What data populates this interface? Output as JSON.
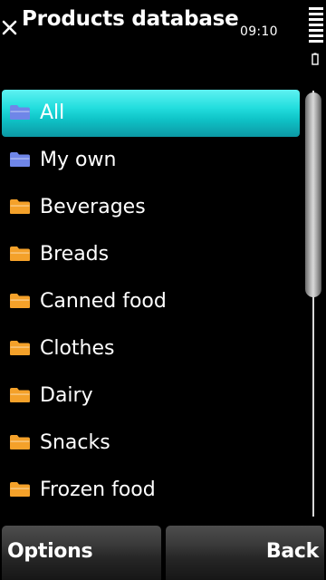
{
  "status_bar": {
    "title": "Products database",
    "time": "09:10",
    "close_icon": "close-icon",
    "signal_icon": "signal-strength-icon",
    "battery_icon": "battery-icon"
  },
  "list": {
    "items": [
      {
        "label": "All",
        "icon": "folder-icon",
        "icon_color": "#6f86e8",
        "selected": true
      },
      {
        "label": "My own",
        "icon": "folder-icon",
        "icon_color": "#6f86e8",
        "selected": false
      },
      {
        "label": "Beverages",
        "icon": "folder-icon",
        "icon_color": "#f4a12a",
        "selected": false
      },
      {
        "label": "Breads",
        "icon": "folder-icon",
        "icon_color": "#f4a12a",
        "selected": false
      },
      {
        "label": "Canned food",
        "icon": "folder-icon",
        "icon_color": "#f4a12a",
        "selected": false
      },
      {
        "label": "Clothes",
        "icon": "folder-icon",
        "icon_color": "#f4a12a",
        "selected": false
      },
      {
        "label": "Dairy",
        "icon": "folder-icon",
        "icon_color": "#f4a12a",
        "selected": false
      },
      {
        "label": "Snacks",
        "icon": "folder-icon",
        "icon_color": "#f4a12a",
        "selected": false
      },
      {
        "label": "Frozen food",
        "icon": "folder-icon",
        "icon_color": "#f4a12a",
        "selected": false
      }
    ],
    "highlight_color": "#1fd3d6"
  },
  "softkeys": {
    "left_label": "Options",
    "right_label": "Back"
  }
}
